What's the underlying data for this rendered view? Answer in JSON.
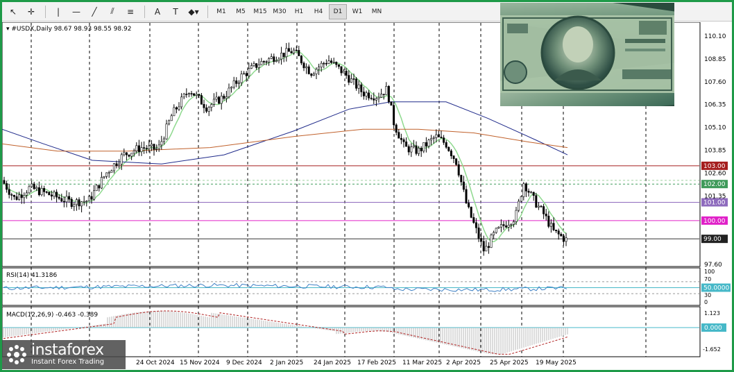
{
  "toolbar": {
    "tools": [
      {
        "name": "cursor-icon",
        "glyph": "↖"
      },
      {
        "name": "crosshair-icon",
        "glyph": "✛"
      },
      {
        "name": "vertical-line-icon",
        "glyph": "|"
      },
      {
        "name": "horizontal-line-icon",
        "glyph": "—"
      },
      {
        "name": "trend-line-icon",
        "glyph": "╱"
      },
      {
        "name": "channel-icon",
        "glyph": "⫽"
      },
      {
        "name": "fibonacci-icon",
        "glyph": "≡"
      },
      {
        "name": "text-icon",
        "glyph": "A"
      },
      {
        "name": "text-label-icon",
        "glyph": "T"
      },
      {
        "name": "shapes-icon",
        "glyph": "◆▾"
      }
    ],
    "timeframes": [
      "M1",
      "M5",
      "M15",
      "M30",
      "H1",
      "H4",
      "D1",
      "W1",
      "MN"
    ],
    "active_timeframe": "D1"
  },
  "chart": {
    "header": "▾ #USDX,Daily  98.67 98.93 98.55 98.92",
    "price_labels": [
      "110.10",
      "108.85",
      "107.60",
      "106.35",
      "105.10",
      "103.85",
      "102.60",
      "101.35",
      "97.60"
    ],
    "level_badges": [
      {
        "label": "103.00",
        "color": "#a51e1e"
      },
      {
        "label": "102.00",
        "color": "#3f9a5a"
      },
      {
        "label": "101.00",
        "color": "#8e6bbd"
      },
      {
        "label": "100.00",
        "color": "#e020c8"
      },
      {
        "label": "99.00",
        "color": "#222222"
      }
    ],
    "date_labels": [
      "24 Oct 2024",
      "15 Nov 2024",
      "9 Dec 2024",
      "2 Jan 2025",
      "24 Jan 2025",
      "17 Feb 2025",
      "11 Mar 2025",
      "2 Apr 2025",
      "25 Apr 2025",
      "19 May 2025"
    ]
  },
  "rsi": {
    "header": "RSI(14) 41.3186",
    "scale": [
      "100",
      "70",
      "30",
      "0"
    ],
    "level_badge": "50.0000"
  },
  "macd": {
    "header": "MACD(12,26,9) -0.463 -0.389",
    "scale": [
      "1.123",
      "-1.652"
    ],
    "level_badge": "0.000"
  },
  "logo": {
    "brand": "instaforex",
    "tagline": "Instant Forex Trading"
  },
  "colors": {
    "frame": "#1e9a48",
    "ma_fast": "#8ed98e",
    "ma_mid": "#1f2a8a",
    "ma_slow": "#c0602a",
    "rsi_line": "#3d7fc4",
    "macd_signal": "#b02020"
  }
}
